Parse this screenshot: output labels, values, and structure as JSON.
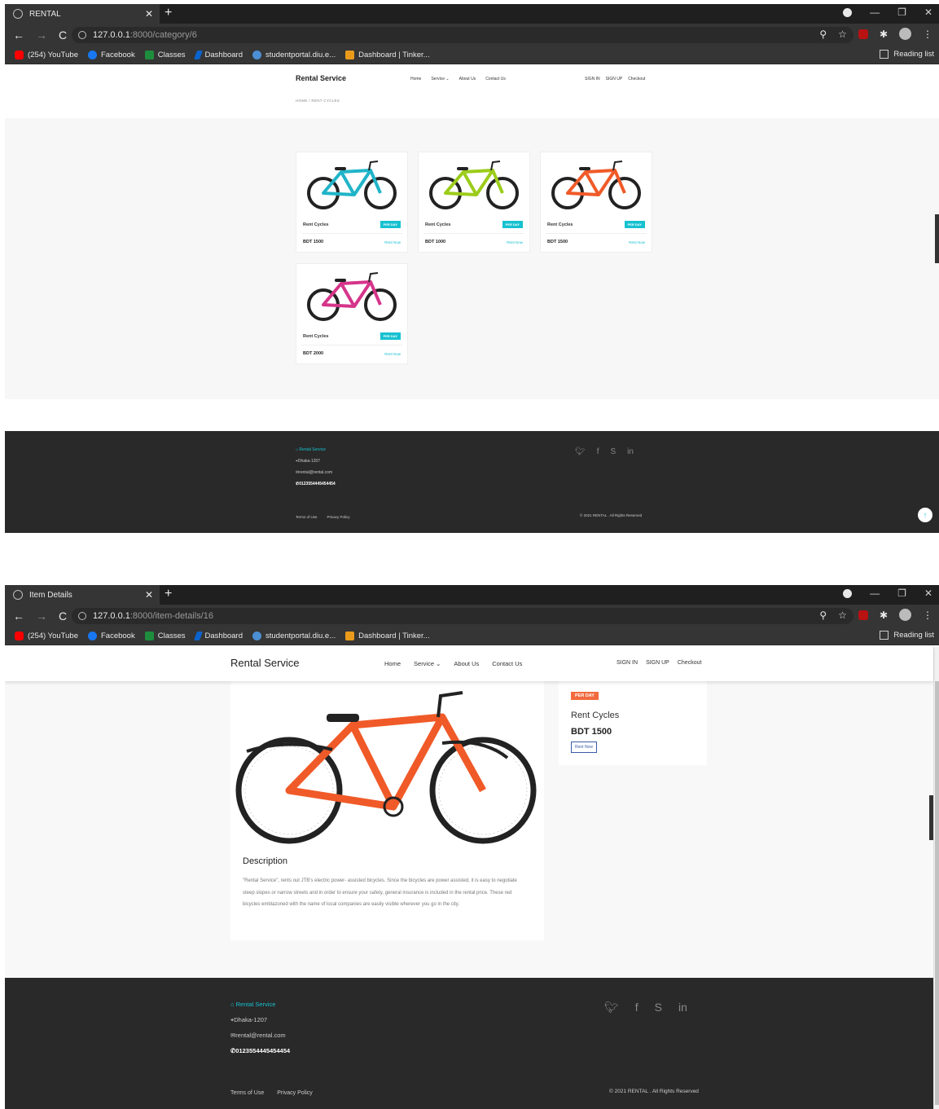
{
  "colors": {
    "accent": "#17c1d0",
    "badge_orange": "#f26a3d",
    "footer": "#292929",
    "chrome": "#353535"
  },
  "browser": {
    "bookmarks": [
      "(254) YouTube",
      "Facebook",
      "Classes",
      "Dashboard",
      "studentportal.diu.e...",
      "Dashboard | Tinker..."
    ],
    "reading_list": "Reading list"
  },
  "shot1": {
    "tab_title": "RENTAL",
    "url_host": "127.0.0.1",
    "url_path": ":8000/category/6",
    "brand": "Rental Service",
    "nav": [
      "Home",
      "Service ⌄",
      "About Us",
      "Contact Us"
    ],
    "auth": [
      "SIGN IN",
      "SIGN UP",
      "Checkout"
    ],
    "breadcrumb": "HOME  /  RENT CYCLES",
    "products": [
      {
        "name": "Rent Cycles",
        "badge": "PER DAY",
        "price": "BDT 1500",
        "action": "Rent Now",
        "color": "#20b4c8"
      },
      {
        "name": "Rent Cycles",
        "badge": "PER DAY",
        "price": "BDT 1000",
        "action": "Rent Now",
        "color": "#9ccc1a"
      },
      {
        "name": "Rent Cycles",
        "badge": "PER DAY",
        "price": "BDT 1500",
        "action": "Rent Now",
        "color": "#f05a28"
      },
      {
        "name": "Rent Cycles",
        "badge": "PER DAY",
        "price": "BDT 2000",
        "action": "Rent Now",
        "color": "#d6348a"
      }
    ],
    "footer": {
      "brand": "Rental Service",
      "address": "Dhaka-1207",
      "email": "rental@rental.com",
      "phone": "0123554445454454",
      "terms": "Terms of Use",
      "privacy": "Privacy Policy",
      "copyright": "© 2021 RENTAL . All Rights Reserved"
    }
  },
  "shot2": {
    "tab_title": "Item Details",
    "url_host": "127.0.0.1",
    "url_path": ":8000/item-details/16",
    "brand": "Rental Service",
    "nav": [
      "Home",
      "Service ⌄",
      "About Us",
      "Contact Us"
    ],
    "auth": [
      "SIGN IN",
      "SIGN UP",
      "Checkout"
    ],
    "item": {
      "badge": "PER DAY",
      "name": "Rent Cycles",
      "price": "BDT 1500",
      "action": "Rent Now",
      "description_title": "Description",
      "description": "\"Rental Service\", rents out JTB's electric power- assisted bicycles. Since the bicycles are power assisted, it is easy to negotiate steep slopes or narrow streets and in order to ensure your safety, general insurance is included in the rental price. These red bicycles emblazoned with the name of local companies are easily visible wherever you go in the city."
    },
    "footer": {
      "brand": "Rental Service",
      "address": "Dhaka-1207",
      "email": "rental@rental.com",
      "phone": "0123554445454454",
      "terms": "Terms of Use",
      "privacy": "Privacy Policy",
      "copyright": "© 2021 RENTAL . All Rights Reserved"
    }
  },
  "icons": [
    "globe-icon",
    "back-icon",
    "forward-icon",
    "reload-icon",
    "info-icon",
    "zoom-icon",
    "star-icon",
    "extensions-icon",
    "menu-icon",
    "twitter-icon",
    "facebook-icon",
    "skype-icon",
    "linkedin-icon",
    "home-icon",
    "location-icon",
    "mail-icon",
    "phone-icon",
    "arrow-up-icon"
  ]
}
